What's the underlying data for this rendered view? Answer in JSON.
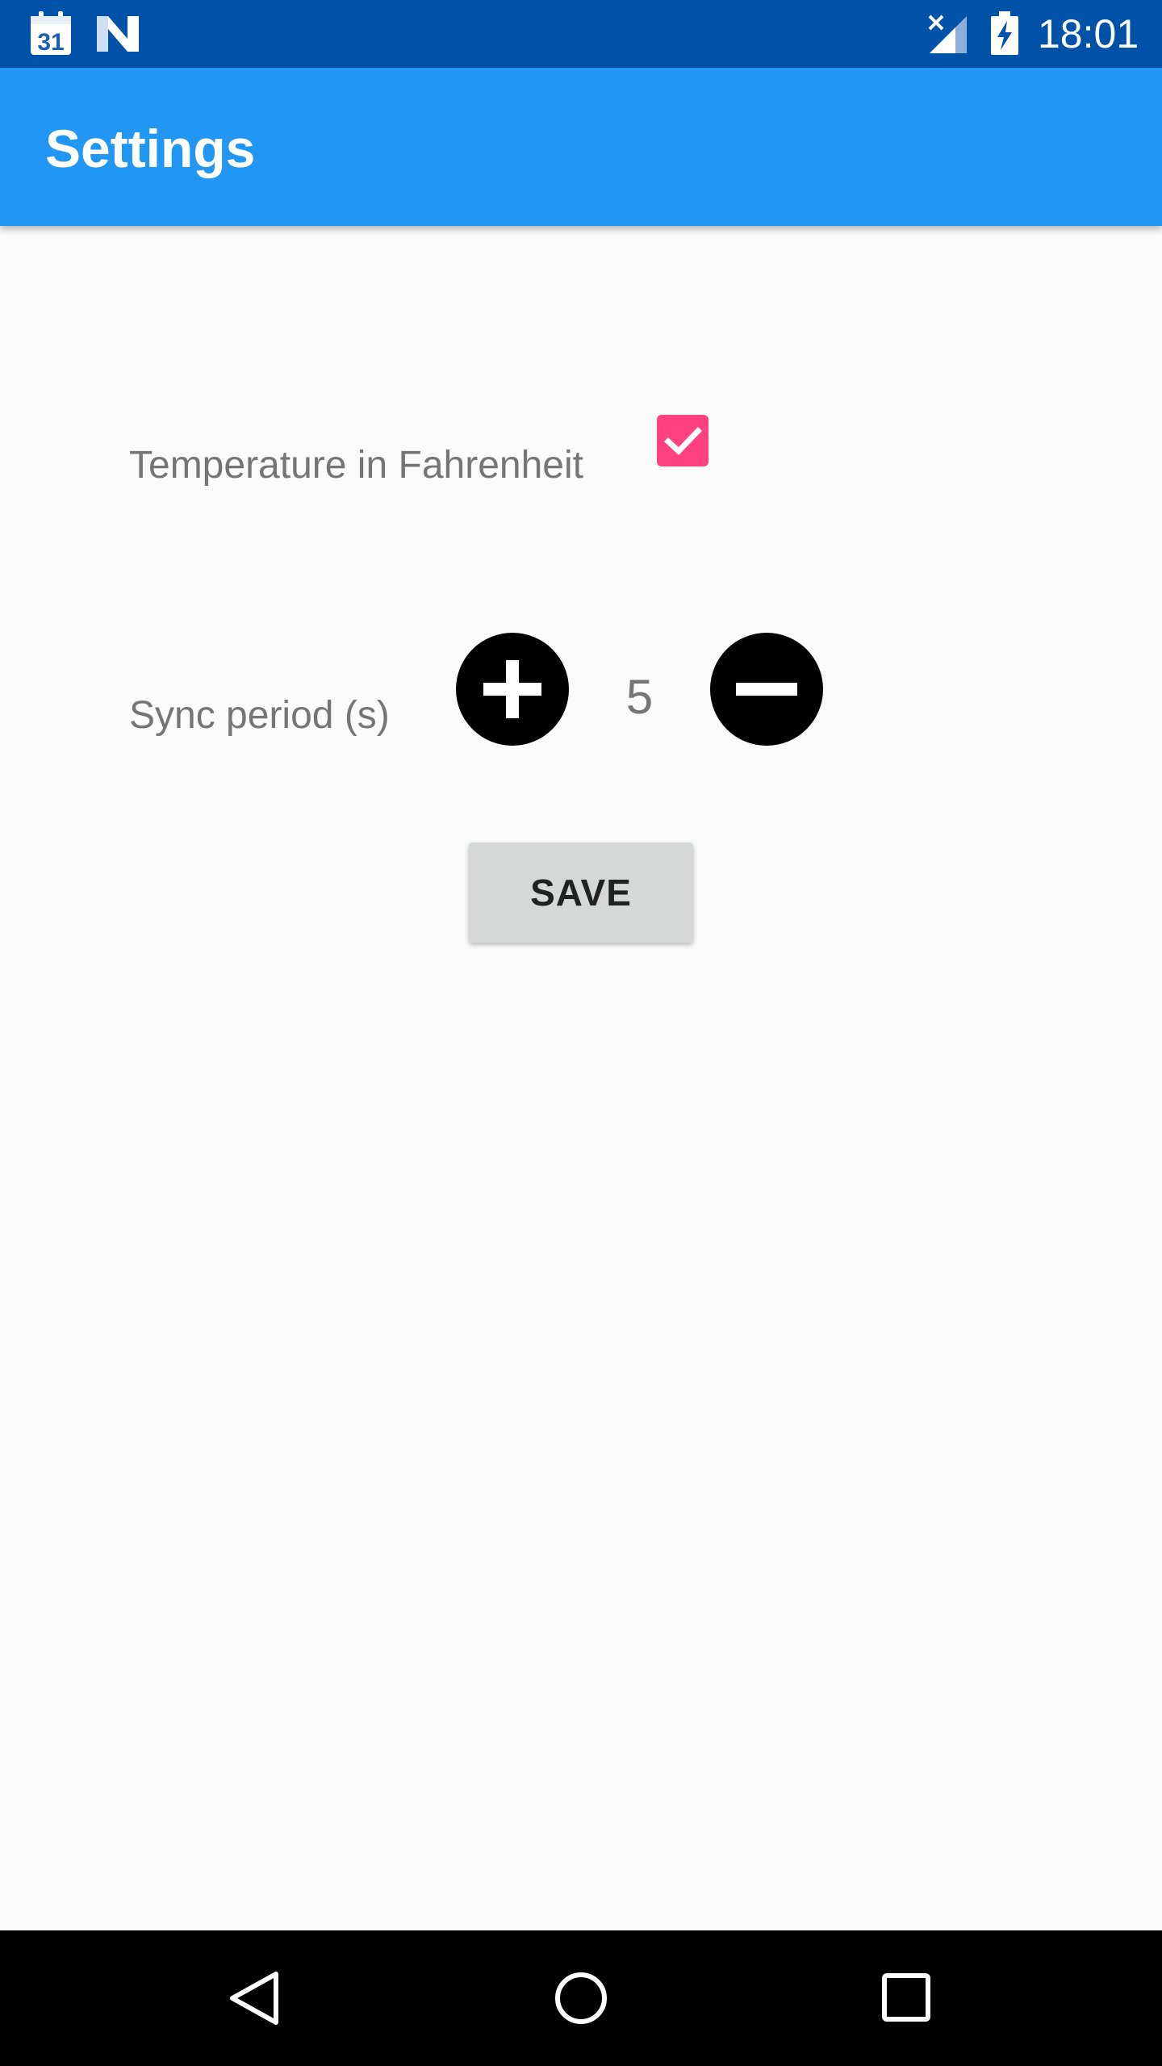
{
  "status_bar": {
    "time": "18:01",
    "calendar_day": "31",
    "icons": [
      "calendar-icon",
      "n-logo-icon",
      "signal-no-data-icon",
      "battery-charging-icon"
    ]
  },
  "app_bar": {
    "title": "Settings",
    "color": "#2196f3"
  },
  "settings": {
    "fahrenheit": {
      "label": "Temperature in Fahrenheit",
      "checked": true,
      "checkbox_color": "#ff4081"
    },
    "sync_period": {
      "label": "Sync period (s)",
      "value": "5",
      "increment_icon": "plus-icon",
      "decrement_icon": "minus-icon"
    },
    "save_label": "SAVE"
  },
  "nav_bar": {
    "icons": [
      "back-icon",
      "home-icon",
      "recents-icon"
    ]
  }
}
